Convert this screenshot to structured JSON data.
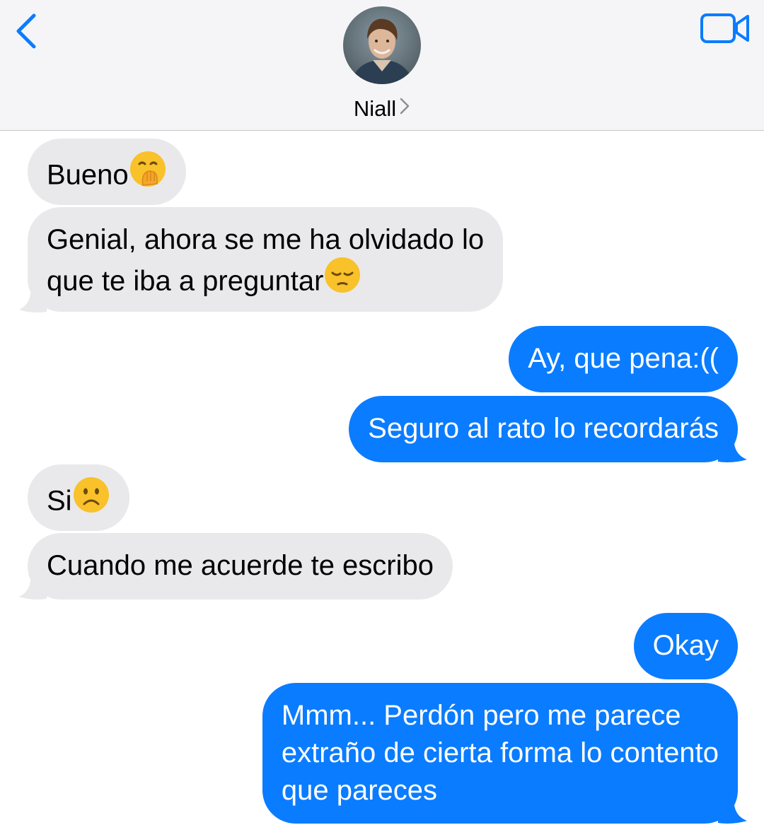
{
  "header": {
    "contact_name": "Niall",
    "back_icon": "chevron-left-icon",
    "video_icon": "video-camera-icon",
    "accent_color": "#0a7cff"
  },
  "messages": [
    {
      "side": "incoming",
      "text": "Bueno",
      "emoji": "face-with-hand-over-mouth"
    },
    {
      "side": "incoming",
      "line1": "Genial, ahora se me ha olvidado lo",
      "line2": "que te iba a preguntar",
      "emoji": "pensive-face"
    },
    {
      "side": "outgoing",
      "text": "Ay, que pena:(("
    },
    {
      "side": "outgoing",
      "text": "Seguro al rato lo recordarás"
    },
    {
      "side": "incoming",
      "text": "Si",
      "emoji": "frowning-face"
    },
    {
      "side": "incoming",
      "text": "Cuando me acuerde te escribo"
    },
    {
      "side": "outgoing",
      "text": "Okay"
    },
    {
      "side": "outgoing",
      "line1": "Mmm... Perdón pero me parece",
      "line2": "extraño de cierta forma lo contento",
      "line3": "que pareces"
    }
  ],
  "colors": {
    "incoming_bubble": "#e9e9eb",
    "outgoing_bubble": "#0a7cff",
    "header_bg": "#f5f5f7"
  }
}
